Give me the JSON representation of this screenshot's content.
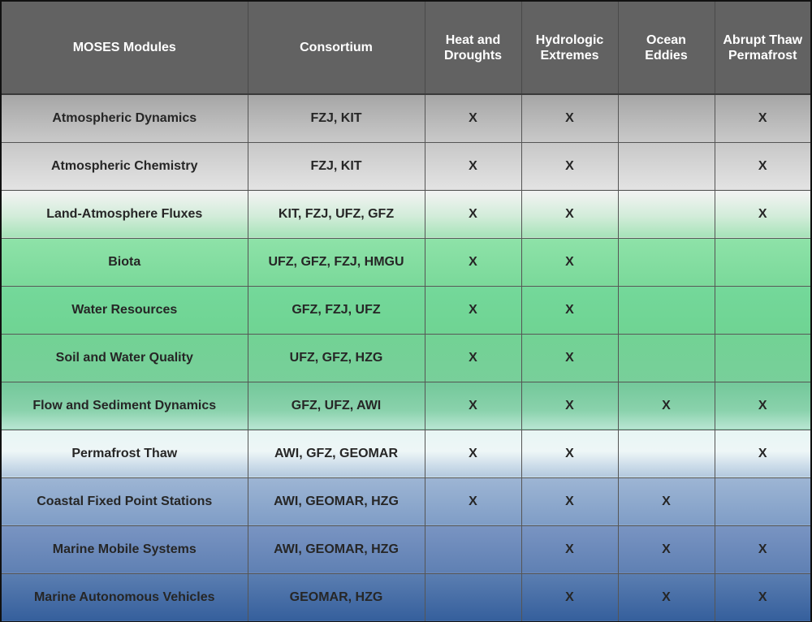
{
  "header": {
    "module": "MOSES Modules",
    "consortium": "Consortium",
    "events": [
      [
        "Heat and",
        "Droughts"
      ],
      [
        "Hydrologic",
        "Extremes"
      ],
      [
        "Ocean",
        "Eddies"
      ],
      [
        "Abrupt Thaw",
        "Permafrost"
      ]
    ]
  },
  "rows": [
    {
      "module": "Atmospheric Dynamics",
      "consortium": "FZJ, KIT",
      "marks": [
        "X",
        "X",
        "",
        "X"
      ]
    },
    {
      "module": "Atmospheric Chemistry",
      "consortium": "FZJ, KIT",
      "marks": [
        "X",
        "X",
        "",
        "X"
      ]
    },
    {
      "module": "Land-Atmosphere Fluxes",
      "consortium": "KIT, FZJ, UFZ, GFZ",
      "marks": [
        "X",
        "X",
        "",
        "X"
      ]
    },
    {
      "module": "Biota",
      "consortium": "UFZ, GFZ, FZJ, HMGU",
      "marks": [
        "X",
        "X",
        "",
        ""
      ]
    },
    {
      "module": "Water Resources",
      "consortium": "GFZ, FZJ, UFZ",
      "marks": [
        "X",
        "X",
        "",
        ""
      ]
    },
    {
      "module": "Soil and Water Quality",
      "consortium": "UFZ, GFZ, HZG",
      "marks": [
        "X",
        "X",
        "",
        ""
      ]
    },
    {
      "module": "Flow and Sediment Dynamics",
      "consortium": "GFZ, UFZ, AWI",
      "marks": [
        "X",
        "X",
        "X",
        "X"
      ]
    },
    {
      "module": "Permafrost Thaw",
      "consortium": "AWI, GFZ, GEOMAR",
      "marks": [
        "X",
        "X",
        "",
        "X"
      ]
    },
    {
      "module": "Coastal Fixed Point Stations",
      "consortium": "AWI, GEOMAR, HZG",
      "marks": [
        "X",
        "X",
        "X",
        ""
      ]
    },
    {
      "module": "Marine Mobile Systems",
      "consortium": "AWI, GEOMAR, HZG",
      "marks": [
        "",
        "X",
        "X",
        "X"
      ]
    },
    {
      "module": "Marine Autonomous Vehicles",
      "consortium": "GEOMAR, HZG",
      "marks": [
        "",
        "X",
        "X",
        "X"
      ]
    }
  ]
}
